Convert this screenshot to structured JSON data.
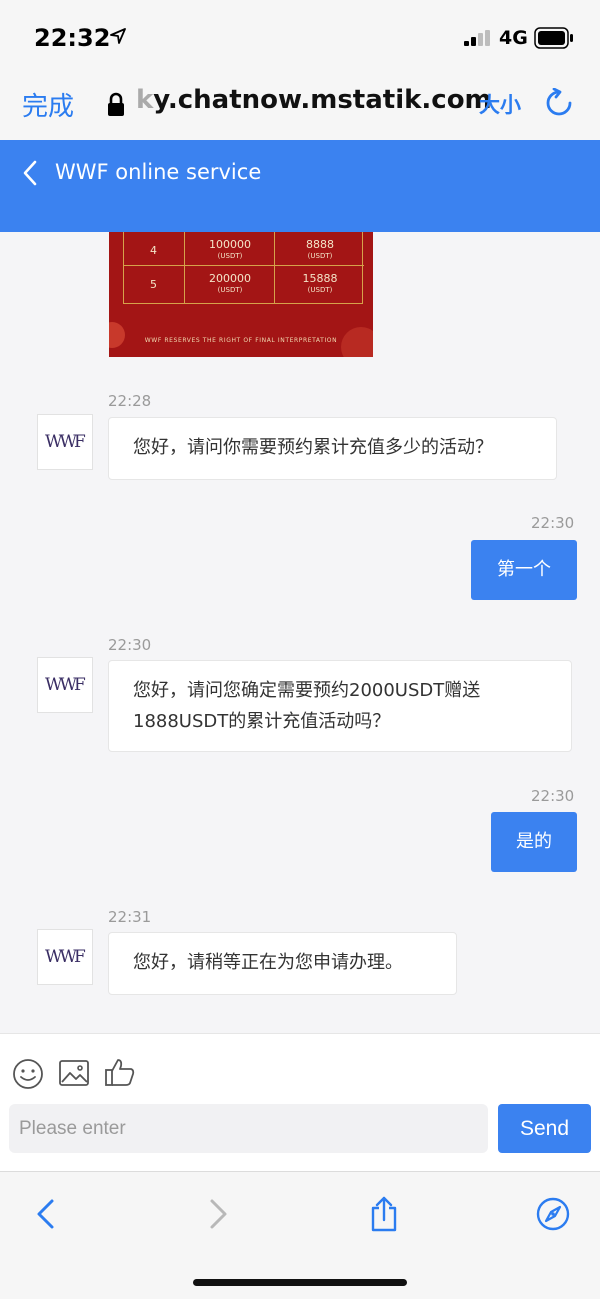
{
  "status_bar": {
    "time": "22:32",
    "network": "4G",
    "icons": [
      "location-arrow-icon",
      "signal-bars-icon",
      "battery-icon"
    ]
  },
  "url_bar": {
    "done_label": "完成",
    "url_prefix": "k",
    "url": "y.chatnow.mstatik.com",
    "text_size_label": "大小",
    "icons": [
      "lock-icon",
      "reload-icon"
    ]
  },
  "header": {
    "title": "WWF online service",
    "icons": [
      "back-chevron-icon"
    ]
  },
  "promo_image": {
    "rows": [
      {
        "index": "4",
        "amount": "100000",
        "bonus": "8888",
        "unit": "(USDT)"
      },
      {
        "index": "5",
        "amount": "200000",
        "bonus": "15888",
        "unit": "(USDT)"
      }
    ],
    "footer": "WWF RESERVES THE RIGHT OF FINAL INTERPRETATION"
  },
  "avatar_logo": "WWF",
  "messages": [
    {
      "direction": "in",
      "time": "22:28",
      "text": "您好，请问你需要预约累计充值多少的活动？"
    },
    {
      "direction": "out",
      "time": "22:30",
      "text": "第一个"
    },
    {
      "direction": "in",
      "time": "22:30",
      "text_line1": "您好，请问您确定需要预约2000USDT赠送",
      "text_line2": "1888USDT的累计充值活动吗？"
    },
    {
      "direction": "out",
      "time": "22:30",
      "text": "是的"
    },
    {
      "direction": "in",
      "time": "22:31",
      "text": "您好，请稍等正在为您申请办理。"
    }
  ],
  "composer": {
    "placeholder": "Please enter",
    "send_label": "Send",
    "icons": [
      "smile-icon",
      "image-icon",
      "thumbs-up-icon"
    ]
  },
  "bottom_toolbar": {
    "icons": [
      "back-arrow-icon",
      "forward-arrow-icon",
      "share-icon",
      "compass-icon"
    ]
  },
  "colors": {
    "accent": "#3b82f0",
    "chat_background": "#f5f5f7",
    "promo_red": "#a31515"
  }
}
